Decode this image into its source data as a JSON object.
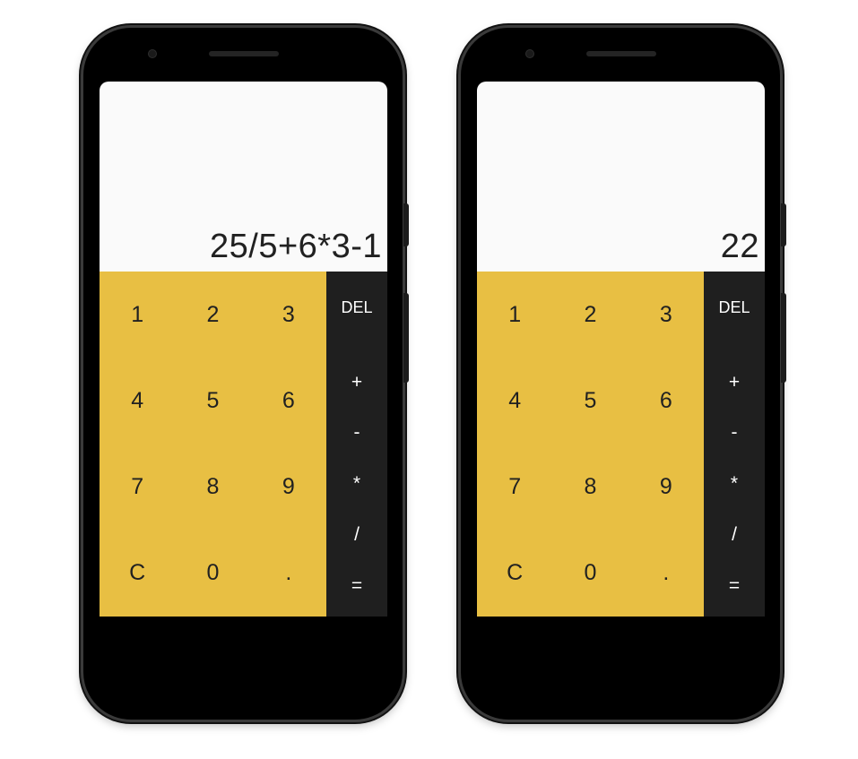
{
  "colors": {
    "display_bg": "#fafafa",
    "keypad_bg": "#e8bf43",
    "operator_bg": "#1f1f1f",
    "phone_body": "#000000"
  },
  "screens": [
    {
      "display": "25/5+6*3-1",
      "digit_keys": [
        "1",
        "2",
        "3",
        "4",
        "5",
        "6",
        "7",
        "8",
        "9",
        "C",
        "0",
        "."
      ],
      "operator_keys": [
        "DEL",
        "+",
        "-",
        "*",
        "/",
        "="
      ]
    },
    {
      "display": "22",
      "digit_keys": [
        "1",
        "2",
        "3",
        "4",
        "5",
        "6",
        "7",
        "8",
        "9",
        "C",
        "0",
        "."
      ],
      "operator_keys": [
        "DEL",
        "+",
        "-",
        "*",
        "/",
        "="
      ]
    }
  ]
}
